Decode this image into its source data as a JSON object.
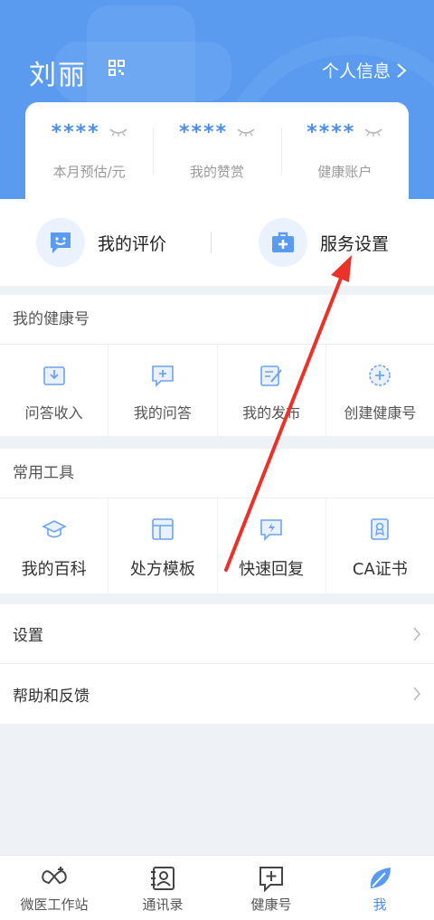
{
  "header": {
    "user_name": "刘丽",
    "personal_info_label": "个人信息"
  },
  "stats": [
    {
      "value": "****",
      "label": "本月预估/元"
    },
    {
      "value": "****",
      "label": "我的赞赏"
    },
    {
      "value": "****",
      "label": "健康账户"
    }
  ],
  "actions": {
    "my_reviews": "我的评价",
    "service_settings": "服务设置"
  },
  "health_section": {
    "title": "我的健康号",
    "items": [
      {
        "label": "问答收入",
        "icon": "download-tray-icon"
      },
      {
        "label": "我的问答",
        "icon": "question-chat-icon"
      },
      {
        "label": "我的发布",
        "icon": "edit-doc-icon"
      },
      {
        "label": "创建健康号",
        "icon": "plus-circle-icon"
      }
    ]
  },
  "tools_section": {
    "title": "常用工具",
    "items": [
      {
        "label": "我的百科",
        "icon": "graduation-cap-icon"
      },
      {
        "label": "处方模板",
        "icon": "template-icon"
      },
      {
        "label": "快速回复",
        "icon": "quick-reply-icon"
      },
      {
        "label": "CA证书",
        "icon": "certificate-icon"
      }
    ]
  },
  "list": {
    "settings": "设置",
    "help": "帮助和反馈"
  },
  "tabbar": [
    {
      "label": "微医工作站",
      "icon": "workstation-icon",
      "active": false
    },
    {
      "label": "通讯录",
      "icon": "contacts-icon",
      "active": false
    },
    {
      "label": "健康号",
      "icon": "health-plus-icon",
      "active": false
    },
    {
      "label": "我",
      "icon": "leaf-icon",
      "active": true
    }
  ],
  "colors": {
    "brand_blue": "#5a9bf0",
    "accent_blue": "#4a8eea",
    "annotation_red": "#e8322a"
  }
}
